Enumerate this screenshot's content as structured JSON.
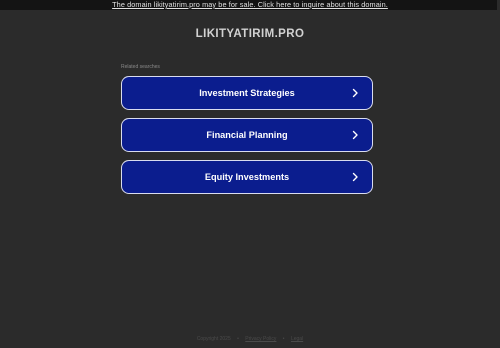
{
  "banner": {
    "text": "The domain likityatirim.pro may be for sale. Click here to inquire about this domain."
  },
  "site": {
    "domain": "LIKITYATIRIM.PRO"
  },
  "related": {
    "heading": "Related searches",
    "items": [
      {
        "label": "Investment Strategies"
      },
      {
        "label": "Financial Planning"
      },
      {
        "label": "Equity Investments"
      }
    ]
  },
  "footer": {
    "copyright": "Copyright 2025",
    "separator": "•",
    "privacy_label": "Privacy Policy",
    "legal_label": "Legal"
  },
  "colors": {
    "background": "#2b2b2b",
    "banner_background": "#141414",
    "button_background": "#0b1d8e",
    "button_border": "#d9dcef"
  },
  "icons": {
    "chevron": "chevron-right-icon"
  }
}
